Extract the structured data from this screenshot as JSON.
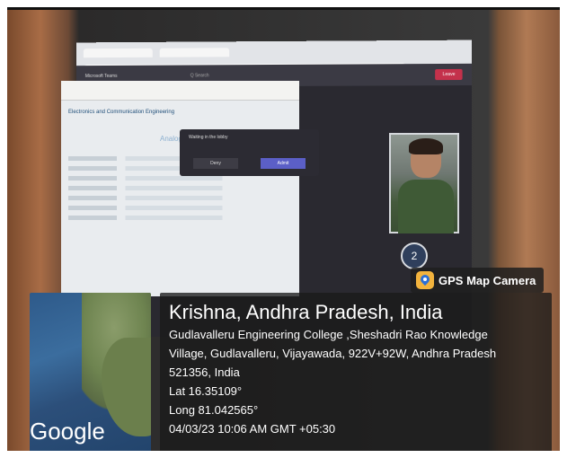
{
  "gps": {
    "badge": "GPS Map Camera",
    "title": "Krishna, Andhra Pradesh, India",
    "address_lines": [
      "Gudlavalleru Engineering College ,Sheshadri Rao Knowledge",
      "Village, Gudlavalleru, Vijayawada, 922V+92W, Andhra Pradesh",
      "521356, India"
    ],
    "lat": "Lat 16.35109°",
    "long": "Long 81.042565°",
    "datetime": "04/03/23 10:06 AM GMT +05:30",
    "map_brand": "Google"
  },
  "screen": {
    "teams_title": "Microsoft Teams",
    "search": "Q Search",
    "leave": "Leave",
    "lobby_text": "Waiting in the lobby",
    "deny": "Deny",
    "admit": "Admit",
    "doc_title": "Electronics and Communication Engineering",
    "doc_subject": "Analog Electronics",
    "participant_count": "2"
  }
}
